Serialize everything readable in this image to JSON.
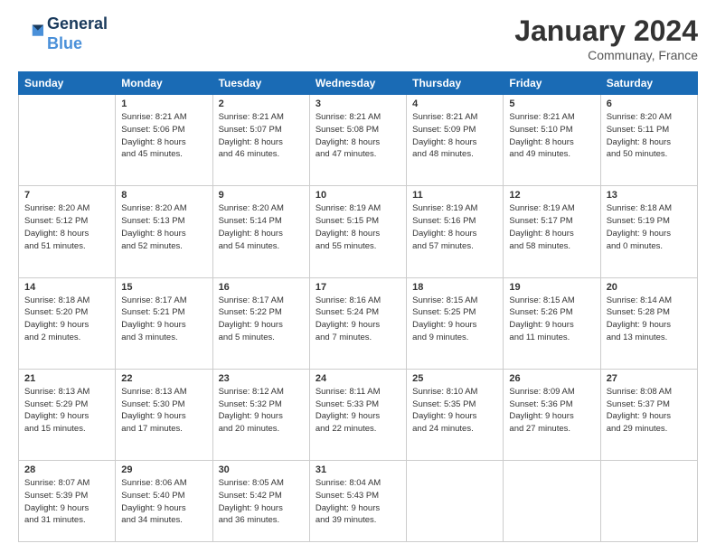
{
  "logo": {
    "line1": "General",
    "line2": "Blue"
  },
  "title": "January 2024",
  "location": "Communay, France",
  "headers": [
    "Sunday",
    "Monday",
    "Tuesday",
    "Wednesday",
    "Thursday",
    "Friday",
    "Saturday"
  ],
  "weeks": [
    [
      {
        "day": "",
        "info": ""
      },
      {
        "day": "1",
        "info": "Sunrise: 8:21 AM\nSunset: 5:06 PM\nDaylight: 8 hours\nand 45 minutes."
      },
      {
        "day": "2",
        "info": "Sunrise: 8:21 AM\nSunset: 5:07 PM\nDaylight: 8 hours\nand 46 minutes."
      },
      {
        "day": "3",
        "info": "Sunrise: 8:21 AM\nSunset: 5:08 PM\nDaylight: 8 hours\nand 47 minutes."
      },
      {
        "day": "4",
        "info": "Sunrise: 8:21 AM\nSunset: 5:09 PM\nDaylight: 8 hours\nand 48 minutes."
      },
      {
        "day": "5",
        "info": "Sunrise: 8:21 AM\nSunset: 5:10 PM\nDaylight: 8 hours\nand 49 minutes."
      },
      {
        "day": "6",
        "info": "Sunrise: 8:20 AM\nSunset: 5:11 PM\nDaylight: 8 hours\nand 50 minutes."
      }
    ],
    [
      {
        "day": "7",
        "info": "Sunrise: 8:20 AM\nSunset: 5:12 PM\nDaylight: 8 hours\nand 51 minutes."
      },
      {
        "day": "8",
        "info": "Sunrise: 8:20 AM\nSunset: 5:13 PM\nDaylight: 8 hours\nand 52 minutes."
      },
      {
        "day": "9",
        "info": "Sunrise: 8:20 AM\nSunset: 5:14 PM\nDaylight: 8 hours\nand 54 minutes."
      },
      {
        "day": "10",
        "info": "Sunrise: 8:19 AM\nSunset: 5:15 PM\nDaylight: 8 hours\nand 55 minutes."
      },
      {
        "day": "11",
        "info": "Sunrise: 8:19 AM\nSunset: 5:16 PM\nDaylight: 8 hours\nand 57 minutes."
      },
      {
        "day": "12",
        "info": "Sunrise: 8:19 AM\nSunset: 5:17 PM\nDaylight: 8 hours\nand 58 minutes."
      },
      {
        "day": "13",
        "info": "Sunrise: 8:18 AM\nSunset: 5:19 PM\nDaylight: 9 hours\nand 0 minutes."
      }
    ],
    [
      {
        "day": "14",
        "info": "Sunrise: 8:18 AM\nSunset: 5:20 PM\nDaylight: 9 hours\nand 2 minutes."
      },
      {
        "day": "15",
        "info": "Sunrise: 8:17 AM\nSunset: 5:21 PM\nDaylight: 9 hours\nand 3 minutes."
      },
      {
        "day": "16",
        "info": "Sunrise: 8:17 AM\nSunset: 5:22 PM\nDaylight: 9 hours\nand 5 minutes."
      },
      {
        "day": "17",
        "info": "Sunrise: 8:16 AM\nSunset: 5:24 PM\nDaylight: 9 hours\nand 7 minutes."
      },
      {
        "day": "18",
        "info": "Sunrise: 8:15 AM\nSunset: 5:25 PM\nDaylight: 9 hours\nand 9 minutes."
      },
      {
        "day": "19",
        "info": "Sunrise: 8:15 AM\nSunset: 5:26 PM\nDaylight: 9 hours\nand 11 minutes."
      },
      {
        "day": "20",
        "info": "Sunrise: 8:14 AM\nSunset: 5:28 PM\nDaylight: 9 hours\nand 13 minutes."
      }
    ],
    [
      {
        "day": "21",
        "info": "Sunrise: 8:13 AM\nSunset: 5:29 PM\nDaylight: 9 hours\nand 15 minutes."
      },
      {
        "day": "22",
        "info": "Sunrise: 8:13 AM\nSunset: 5:30 PM\nDaylight: 9 hours\nand 17 minutes."
      },
      {
        "day": "23",
        "info": "Sunrise: 8:12 AM\nSunset: 5:32 PM\nDaylight: 9 hours\nand 20 minutes."
      },
      {
        "day": "24",
        "info": "Sunrise: 8:11 AM\nSunset: 5:33 PM\nDaylight: 9 hours\nand 22 minutes."
      },
      {
        "day": "25",
        "info": "Sunrise: 8:10 AM\nSunset: 5:35 PM\nDaylight: 9 hours\nand 24 minutes."
      },
      {
        "day": "26",
        "info": "Sunrise: 8:09 AM\nSunset: 5:36 PM\nDaylight: 9 hours\nand 27 minutes."
      },
      {
        "day": "27",
        "info": "Sunrise: 8:08 AM\nSunset: 5:37 PM\nDaylight: 9 hours\nand 29 minutes."
      }
    ],
    [
      {
        "day": "28",
        "info": "Sunrise: 8:07 AM\nSunset: 5:39 PM\nDaylight: 9 hours\nand 31 minutes."
      },
      {
        "day": "29",
        "info": "Sunrise: 8:06 AM\nSunset: 5:40 PM\nDaylight: 9 hours\nand 34 minutes."
      },
      {
        "day": "30",
        "info": "Sunrise: 8:05 AM\nSunset: 5:42 PM\nDaylight: 9 hours\nand 36 minutes."
      },
      {
        "day": "31",
        "info": "Sunrise: 8:04 AM\nSunset: 5:43 PM\nDaylight: 9 hours\nand 39 minutes."
      },
      {
        "day": "",
        "info": ""
      },
      {
        "day": "",
        "info": ""
      },
      {
        "day": "",
        "info": ""
      }
    ]
  ]
}
